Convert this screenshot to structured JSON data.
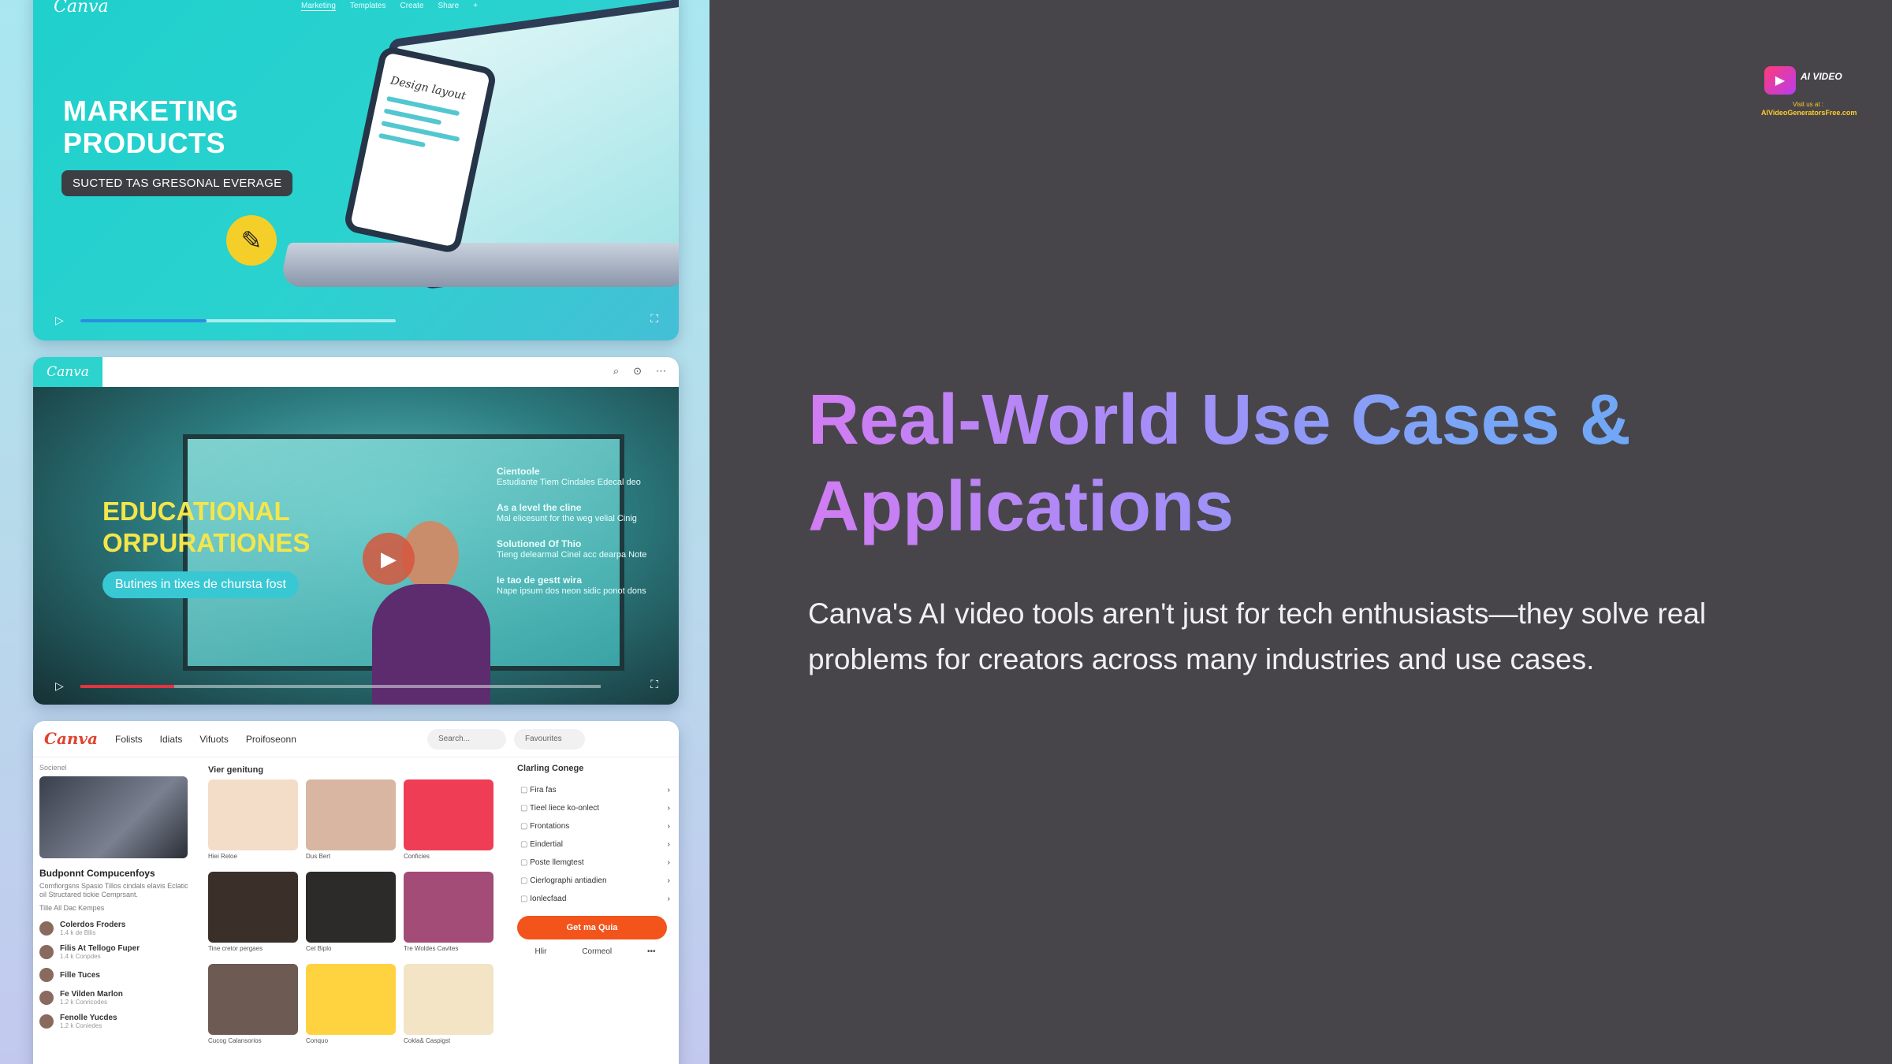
{
  "slide": {
    "headline": "Real-World Use Cases & Applications",
    "body": "Canva's AI video tools aren't just for tech enthusiasts—they solve real problems for creators across many industries and use cases."
  },
  "brand": {
    "name": "AI VIDEO",
    "visit": "Visit us at :",
    "url": "AIVideoGeneratorsFree.com"
  },
  "card1": {
    "logo": "Canva",
    "nav": [
      "Marketing",
      "Templates",
      "Create",
      "Share",
      "+"
    ],
    "title": "MARKETING PRODUCTS",
    "pill": "SUCTED TAS GRESONAL EVERAGE",
    "phone_title": "Design layout",
    "progress": 0.4,
    "colors": {
      "accent": "#2dd3cd",
      "pen": "#f4cf29"
    }
  },
  "card2": {
    "logo": "Canva",
    "title_line1": "EDUCATIONAL",
    "title_line2": "ORPURATIONES",
    "pill": "Butines in tixes de chursta fost",
    "list": [
      {
        "head": "Cientoole",
        "text": "Estudiante Tiem Cindales Edecal deo"
      },
      {
        "head": "As a level the cline",
        "text": "Mal elicesunt for the weg velial Cinig"
      },
      {
        "head": "Solutioned Of Thio",
        "text": "Tieng delearmal Cinel acc dearpa Note"
      },
      {
        "head": "Ie tao de gestt wira",
        "text": "Nape ipsum dos neon sidic ponot dons"
      }
    ],
    "progress": 0.18
  },
  "card3": {
    "logo": "Canva",
    "nav": [
      "Folists",
      "Idiats",
      "Vifuots",
      "Proifoseonn"
    ],
    "search": "Search...",
    "fav": "Favourites",
    "side_label": "Socienel",
    "side_title": "Budponnt Compucenfoys",
    "side_desc": "Comfiorgsns Spasio Tillos cindals elavis Eclatic oil Structared tickie Cemprsant.",
    "side_sub": "Tille All Dac Kempes",
    "people": [
      {
        "name": "Colerdos Froders",
        "meta": "1.4 k de Bllis"
      },
      {
        "name": "Filis At Tellogo Fuper",
        "meta": "1.4 k Conpdes"
      },
      {
        "name": "Fille Tuces",
        "meta": ""
      },
      {
        "name": "Fe Vilden Marlon",
        "meta": "1.2 k Conricodes"
      },
      {
        "name": "Fenolle Yucdes",
        "meta": "1.2 k Coniedes"
      }
    ],
    "grid_title": "Vier genitung",
    "tiles": [
      {
        "caption": "Hiei Reloe",
        "color": "#f3ddc8"
      },
      {
        "caption": "Dus Bert",
        "color": "#d9b6a2"
      },
      {
        "caption": "Conficies",
        "color": "#ef3d56"
      },
      {
        "caption": "Tine cretor pergaes",
        "color": "#3b2f2a"
      },
      {
        "caption": "Cet Biplo",
        "color": "#2d2a2a"
      },
      {
        "caption": "Tre Woldes Cavites",
        "color": "#a24c77"
      },
      {
        "caption": "Cucog Calansorios",
        "color": "#6d5a52"
      },
      {
        "caption": "Conquo",
        "color": "#ffd23f"
      },
      {
        "caption": "Cokla& Caspigst",
        "color": "#f2e4c4"
      }
    ],
    "right_title": "Clarling Conege",
    "right_items": [
      "Fira fas",
      "Tieel liece ko-onlect",
      "Frontations",
      "Eindertial",
      "Poste llemgtest",
      "Cierlographi antiadien",
      "Ionlecfaad"
    ],
    "cta": "Get ma Quia",
    "foot": [
      "Hlir",
      "Cormeol",
      "•••"
    ]
  }
}
